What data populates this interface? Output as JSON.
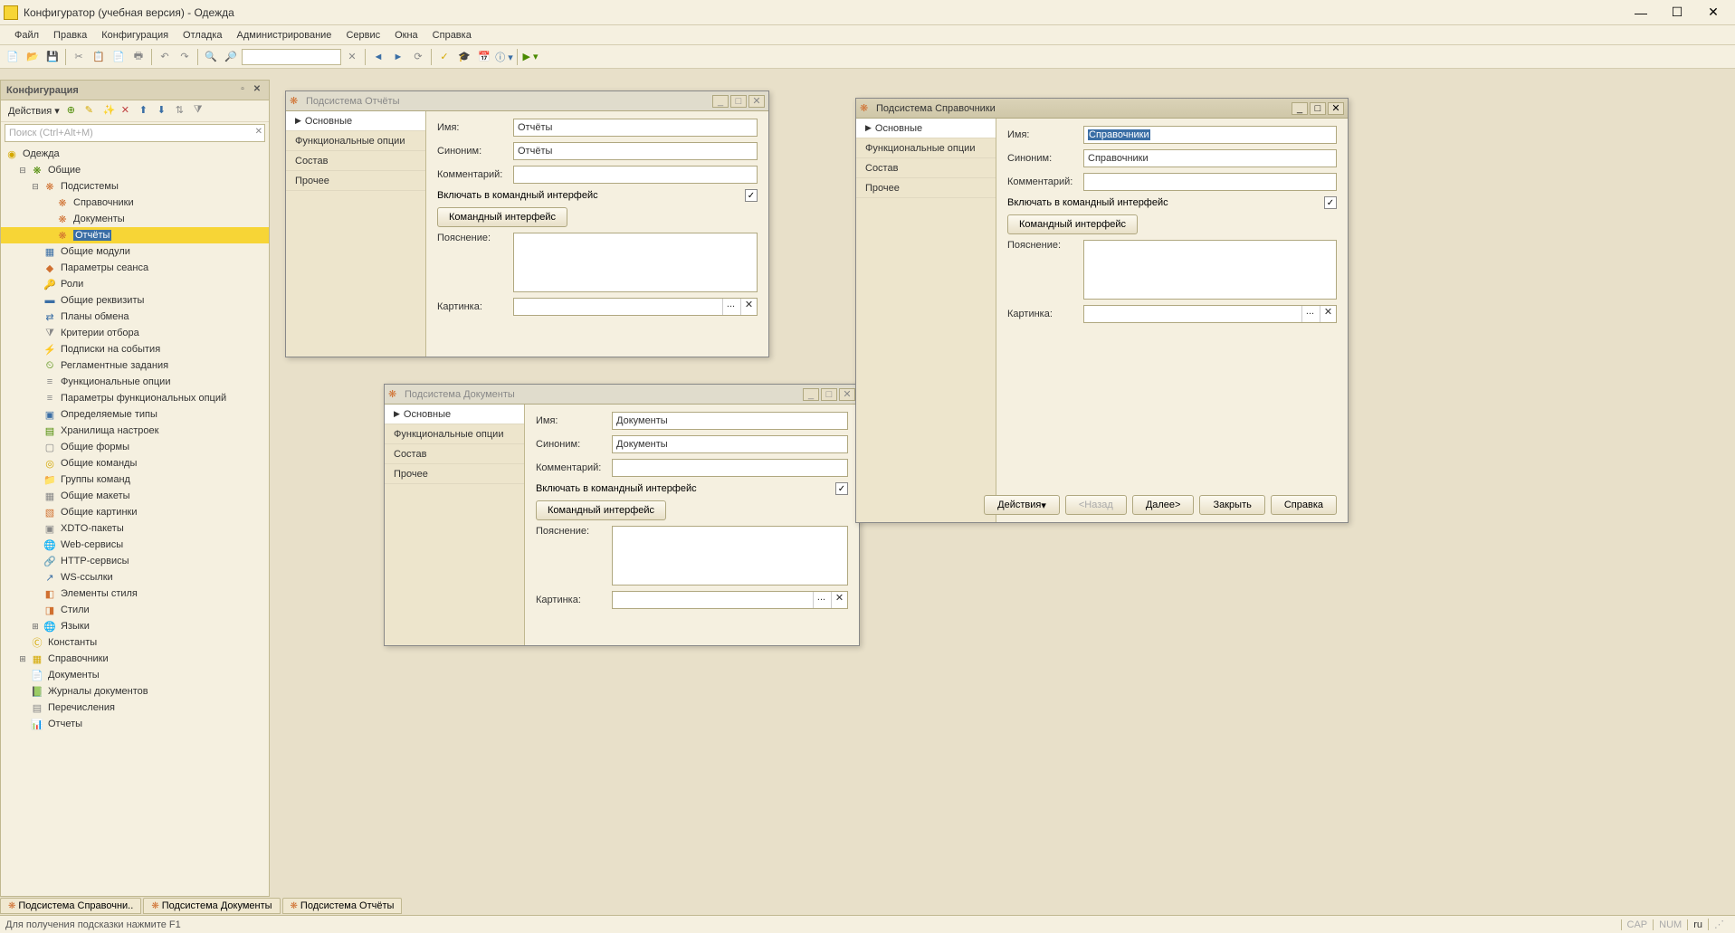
{
  "app": {
    "title": "Конфигуратор (учебная версия) - Одежда"
  },
  "menu": {
    "file": "Файл",
    "edit": "Правка",
    "config": "Конфигурация",
    "debug": "Отладка",
    "admin": "Администрирование",
    "service": "Сервис",
    "windows": "Окна",
    "help": "Справка"
  },
  "config_panel": {
    "title": "Конфигурация",
    "actions_label": "Действия",
    "search_placeholder": "Поиск (Ctrl+Alt+M)"
  },
  "tree": {
    "root": "Одежда",
    "common": "Общие",
    "subsystems": "Подсистемы",
    "sub_reference": "Справочники",
    "sub_documents": "Документы",
    "sub_reports": "Отчёты",
    "common_modules": "Общие модули",
    "session_params": "Параметры сеанса",
    "roles": "Роли",
    "common_attrs": "Общие реквизиты",
    "exchange_plans": "Планы обмена",
    "filter_criteria": "Критерии отбора",
    "event_subs": "Подписки на события",
    "scheduled_jobs": "Регламентные задания",
    "func_options": "Функциональные опции",
    "func_opt_params": "Параметры функциональных опций",
    "defined_types": "Определяемые типы",
    "settings_storage": "Хранилища настроек",
    "common_forms": "Общие формы",
    "common_commands": "Общие команды",
    "command_groups": "Группы команд",
    "common_templates": "Общие макеты",
    "common_pictures": "Общие картинки",
    "xdto": "XDTO-пакеты",
    "web_services": "Web-сервисы",
    "http_services": "HTTP-сервисы",
    "ws_links": "WS-ссылки",
    "style_elements": "Элементы стиля",
    "styles": "Стили",
    "languages": "Языки",
    "constants": "Константы",
    "catalogs": "Справочники",
    "documents": "Документы",
    "doc_journals": "Журналы документов",
    "enums": "Перечисления",
    "reports": "Отчеты"
  },
  "dialogs": {
    "common": {
      "tab_main": "Основные",
      "tab_func": "Функциональные опции",
      "tab_comp": "Состав",
      "tab_other": "Прочее",
      "label_name": "Имя:",
      "label_synonym": "Синоним:",
      "label_comment": "Комментарий:",
      "label_include": "Включать в командный интерфейс",
      "btn_cmd": "Командный интерфейс",
      "label_explain": "Пояснение:",
      "label_picture": "Картинка:",
      "btn_actions": "Действия",
      "btn_back": "<Назад",
      "btn_next": "Далее>",
      "btn_close": "Закрыть",
      "btn_help": "Справка"
    },
    "reports": {
      "title": "Подсистема Отчёты",
      "name": "Отчёты",
      "synonym": "Отчёты"
    },
    "docs": {
      "title": "Подсистема Документы",
      "name": "Документы",
      "synonym": "Документы"
    },
    "refs": {
      "title": "Подсистема Справочники",
      "name": "Справочники",
      "synonym": "Справочники"
    }
  },
  "bottom_tabs": {
    "t1": "Подсистема Справочни..",
    "t2": "Подсистема Документы",
    "t3": "Подсистема Отчёты"
  },
  "status": {
    "hint": "Для получения подсказки нажмите F1",
    "cap": "CAP",
    "num": "NUM",
    "lang": "ru"
  }
}
